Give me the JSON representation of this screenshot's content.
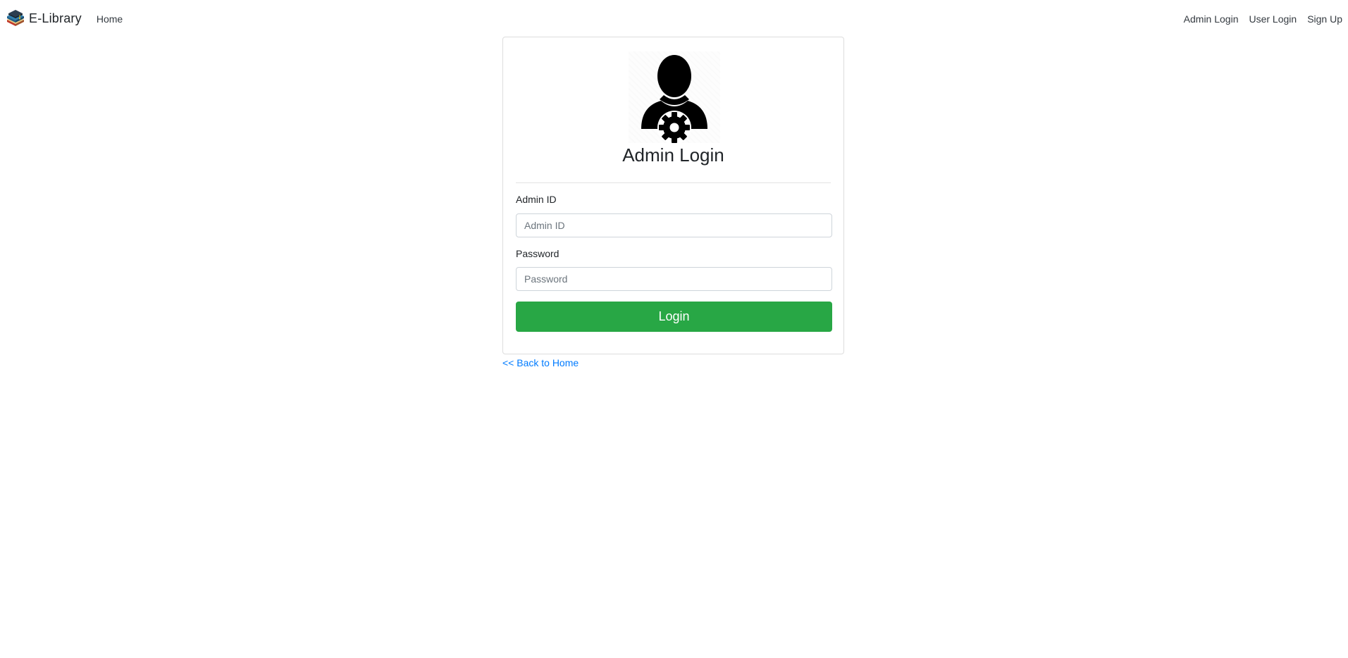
{
  "navbar": {
    "brand": "E-Library",
    "left_links": [
      "Home"
    ],
    "right_links": [
      "Admin Login",
      "User Login",
      "Sign Up"
    ]
  },
  "login_card": {
    "title": "Admin Login",
    "avatar_icon": "admin-user-gear-icon",
    "admin_id_label": "Admin ID",
    "admin_id_placeholder": "Admin ID",
    "admin_id_value": "",
    "password_label": "Password",
    "password_placeholder": "Password",
    "password_value": "",
    "login_button": "Login"
  },
  "back_link": "<< Back to Home",
  "colors": {
    "primary_link": "#007bff",
    "success_button": "#28a745"
  }
}
